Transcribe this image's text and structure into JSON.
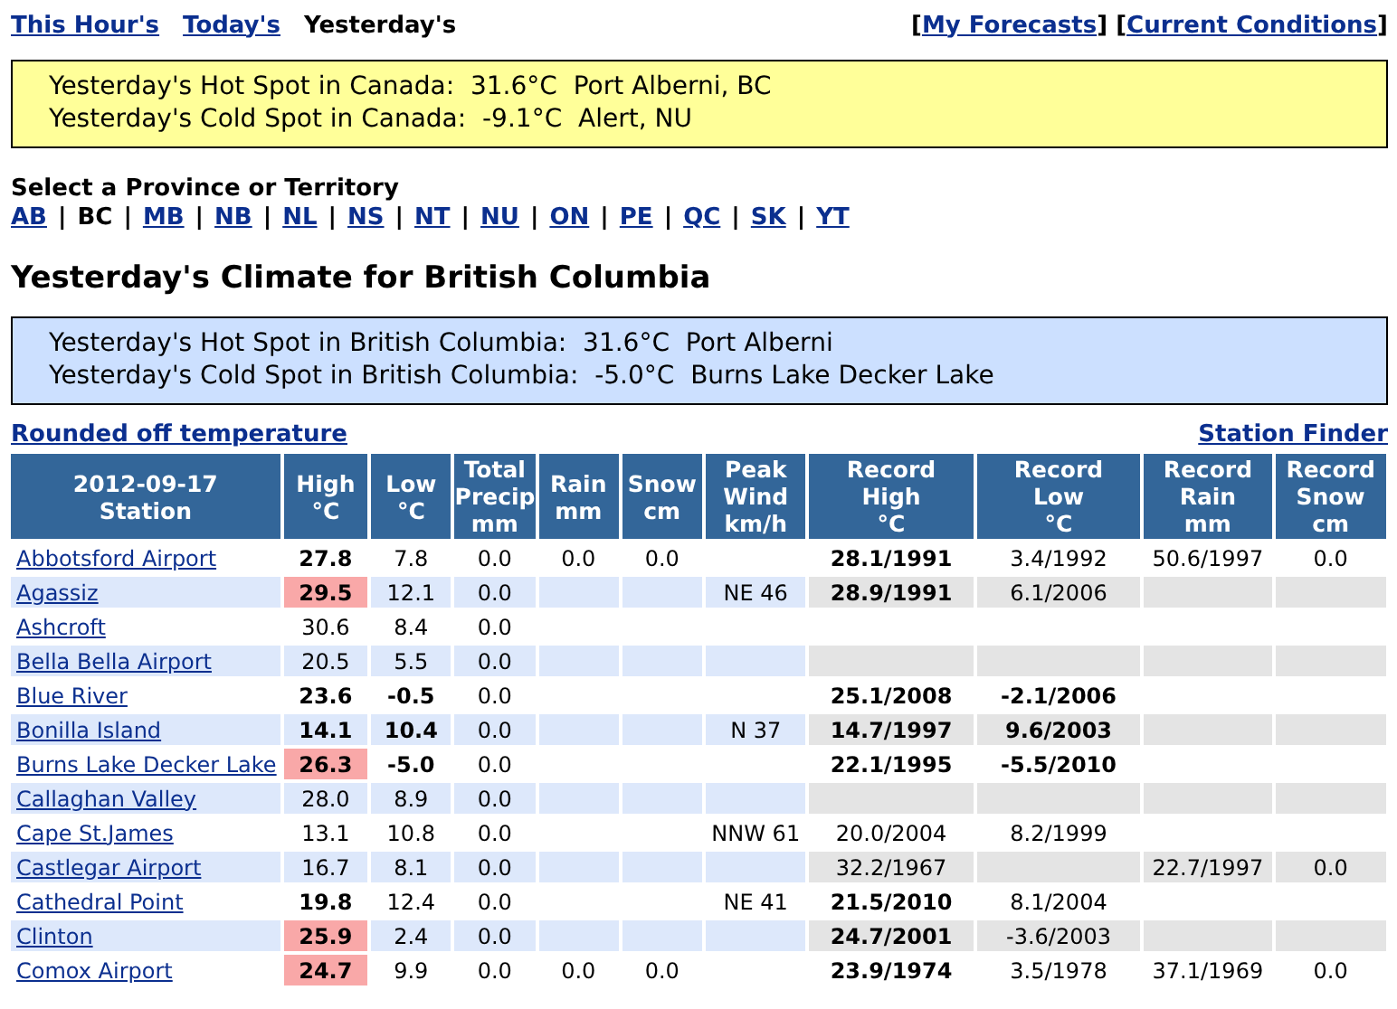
{
  "nav": {
    "tabs": [
      {
        "label": "This Hour's",
        "selected": false
      },
      {
        "label": "Today's",
        "selected": false
      },
      {
        "label": "Yesterday's",
        "selected": true
      }
    ],
    "links": {
      "bracket_open": "[",
      "bracket_close": "]",
      "items": [
        "My Forecasts",
        "Current Conditions"
      ]
    }
  },
  "canada_spots": {
    "lines": [
      "Yesterday's Hot Spot in Canada:  31.6°C  Port Alberni, BC",
      "Yesterday's Cold Spot in Canada:  -9.1°C  Alert, NU"
    ]
  },
  "provinces": {
    "title": "Select a Province or Territory",
    "separator": "|",
    "items": [
      {
        "label": "AB",
        "selected": false
      },
      {
        "label": "BC",
        "selected": true
      },
      {
        "label": "MB",
        "selected": false
      },
      {
        "label": "NB",
        "selected": false
      },
      {
        "label": "NL",
        "selected": false
      },
      {
        "label": "NS",
        "selected": false
      },
      {
        "label": "NT",
        "selected": false
      },
      {
        "label": "NU",
        "selected": false
      },
      {
        "label": "ON",
        "selected": false
      },
      {
        "label": "PE",
        "selected": false
      },
      {
        "label": "QC",
        "selected": false
      },
      {
        "label": "SK",
        "selected": false
      },
      {
        "label": "YT",
        "selected": false
      }
    ]
  },
  "heading": "Yesterday's Climate for British Columbia",
  "province_spots": {
    "lines": [
      "Yesterday's Hot Spot in British Columbia:  31.6°C  Port Alberni",
      "Yesterday's Cold Spot in British Columbia:  -5.0°C  Burns Lake Decker Lake"
    ]
  },
  "table_links": {
    "left": "Rounded off temperature",
    "right": "Station Finder"
  },
  "table": {
    "station_column": "2012-09-17\nStation",
    "columns": [
      "High\n°C",
      "Low\n°C",
      "Total\nPrecip\nmm",
      "Rain\nmm",
      "Snow\ncm",
      "Peak\nWind\nkm/h",
      "Record\nHigh\n°C",
      "Record\nLow\n°C",
      "Record\nRain\nmm",
      "Record\nSnow\ncm"
    ],
    "rows": [
      {
        "station": "Abbotsford Airport",
        "cells": [
          {
            "value": "27.8",
            "bold": true,
            "hot": false
          },
          {
            "value": "7.8",
            "bold": false,
            "hot": false
          },
          {
            "value": "0.0",
            "bold": false,
            "hot": false
          },
          {
            "value": "0.0",
            "bold": false,
            "hot": false
          },
          {
            "value": "0.0",
            "bold": false,
            "hot": false
          },
          null,
          {
            "value": "28.1/1991",
            "bold": true,
            "hot": false
          },
          {
            "value": "3.4/1992",
            "bold": false,
            "hot": false
          },
          {
            "value": "50.6/1997",
            "bold": false,
            "hot": false
          },
          {
            "value": "0.0",
            "bold": false,
            "hot": false
          }
        ]
      },
      {
        "station": "Agassiz",
        "cells": [
          {
            "value": "29.5",
            "bold": true,
            "hot": true
          },
          {
            "value": "12.1",
            "bold": false,
            "hot": false
          },
          {
            "value": "0.0",
            "bold": false,
            "hot": false
          },
          null,
          null,
          {
            "value": "NE 46",
            "bold": false,
            "hot": false
          },
          {
            "value": "28.9/1991",
            "bold": true,
            "hot": false
          },
          {
            "value": "6.1/2006",
            "bold": false,
            "hot": false
          },
          null,
          null
        ]
      },
      {
        "station": "Ashcroft",
        "cells": [
          {
            "value": "30.6",
            "bold": false,
            "hot": false
          },
          {
            "value": "8.4",
            "bold": false,
            "hot": false
          },
          {
            "value": "0.0",
            "bold": false,
            "hot": false
          },
          null,
          null,
          null,
          null,
          null,
          null,
          null
        ]
      },
      {
        "station": "Bella Bella Airport",
        "cells": [
          {
            "value": "20.5",
            "bold": false,
            "hot": false
          },
          {
            "value": "5.5",
            "bold": false,
            "hot": false
          },
          {
            "value": "0.0",
            "bold": false,
            "hot": false
          },
          null,
          null,
          null,
          null,
          null,
          null,
          null
        ]
      },
      {
        "station": "Blue River",
        "cells": [
          {
            "value": "23.6",
            "bold": true,
            "hot": false
          },
          {
            "value": "-0.5",
            "bold": true,
            "hot": false
          },
          {
            "value": "0.0",
            "bold": false,
            "hot": false
          },
          null,
          null,
          null,
          {
            "value": "25.1/2008",
            "bold": true,
            "hot": false
          },
          {
            "value": "-2.1/2006",
            "bold": true,
            "hot": false
          },
          null,
          null
        ]
      },
      {
        "station": "Bonilla Island",
        "cells": [
          {
            "value": "14.1",
            "bold": true,
            "hot": false
          },
          {
            "value": "10.4",
            "bold": true,
            "hot": false
          },
          {
            "value": "0.0",
            "bold": false,
            "hot": false
          },
          null,
          null,
          {
            "value": "N 37",
            "bold": false,
            "hot": false
          },
          {
            "value": "14.7/1997",
            "bold": true,
            "hot": false
          },
          {
            "value": "9.6/2003",
            "bold": true,
            "hot": false
          },
          null,
          null
        ]
      },
      {
        "station": "Burns Lake Decker Lake",
        "cells": [
          {
            "value": "26.3",
            "bold": true,
            "hot": true
          },
          {
            "value": "-5.0",
            "bold": true,
            "hot": false
          },
          {
            "value": "0.0",
            "bold": false,
            "hot": false
          },
          null,
          null,
          null,
          {
            "value": "22.1/1995",
            "bold": true,
            "hot": false
          },
          {
            "value": "-5.5/2010",
            "bold": true,
            "hot": false
          },
          null,
          null
        ]
      },
      {
        "station": "Callaghan Valley",
        "cells": [
          {
            "value": "28.0",
            "bold": false,
            "hot": false
          },
          {
            "value": "8.9",
            "bold": false,
            "hot": false
          },
          {
            "value": "0.0",
            "bold": false,
            "hot": false
          },
          null,
          null,
          null,
          null,
          null,
          null,
          null
        ]
      },
      {
        "station": "Cape St.James",
        "cells": [
          {
            "value": "13.1",
            "bold": false,
            "hot": false
          },
          {
            "value": "10.8",
            "bold": false,
            "hot": false
          },
          {
            "value": "0.0",
            "bold": false,
            "hot": false
          },
          null,
          null,
          {
            "value": "NNW 61",
            "bold": false,
            "hot": false
          },
          {
            "value": "20.0/2004",
            "bold": false,
            "hot": false
          },
          {
            "value": "8.2/1999",
            "bold": false,
            "hot": false
          },
          null,
          null
        ]
      },
      {
        "station": "Castlegar Airport",
        "cells": [
          {
            "value": "16.7",
            "bold": false,
            "hot": false
          },
          {
            "value": "8.1",
            "bold": false,
            "hot": false
          },
          {
            "value": "0.0",
            "bold": false,
            "hot": false
          },
          null,
          null,
          null,
          {
            "value": "32.2/1967",
            "bold": false,
            "hot": false
          },
          null,
          {
            "value": "22.7/1997",
            "bold": false,
            "hot": false
          },
          {
            "value": "0.0",
            "bold": false,
            "hot": false
          }
        ]
      },
      {
        "station": "Cathedral Point",
        "cells": [
          {
            "value": "19.8",
            "bold": true,
            "hot": false
          },
          {
            "value": "12.4",
            "bold": false,
            "hot": false
          },
          {
            "value": "0.0",
            "bold": false,
            "hot": false
          },
          null,
          null,
          {
            "value": "NE 41",
            "bold": false,
            "hot": false
          },
          {
            "value": "21.5/2010",
            "bold": true,
            "hot": false
          },
          {
            "value": "8.1/2004",
            "bold": false,
            "hot": false
          },
          null,
          null
        ]
      },
      {
        "station": "Clinton",
        "cells": [
          {
            "value": "25.9",
            "bold": true,
            "hot": true
          },
          {
            "value": "2.4",
            "bold": false,
            "hot": false
          },
          {
            "value": "0.0",
            "bold": false,
            "hot": false
          },
          null,
          null,
          null,
          {
            "value": "24.7/2001",
            "bold": true,
            "hot": false
          },
          {
            "value": "-3.6/2003",
            "bold": false,
            "hot": false
          },
          null,
          null
        ]
      },
      {
        "station": "Comox Airport",
        "cells": [
          {
            "value": "24.7",
            "bold": true,
            "hot": true
          },
          {
            "value": "9.9",
            "bold": false,
            "hot": false
          },
          {
            "value": "0.0",
            "bold": false,
            "hot": false
          },
          {
            "value": "0.0",
            "bold": false,
            "hot": false
          },
          {
            "value": "0.0",
            "bold": false,
            "hot": false
          },
          null,
          {
            "value": "23.9/1974",
            "bold": true,
            "hot": false
          },
          {
            "value": "3.5/1978",
            "bold": false,
            "hot": false
          },
          {
            "value": "37.1/1969",
            "bold": false,
            "hot": false
          },
          {
            "value": "0.0",
            "bold": false,
            "hot": false
          }
        ]
      }
    ]
  }
}
